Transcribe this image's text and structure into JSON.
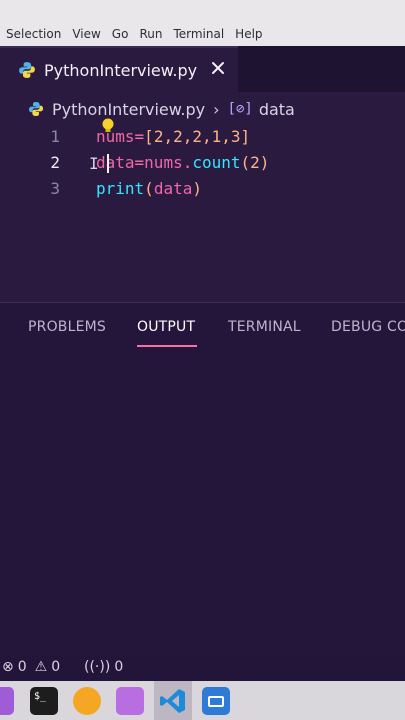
{
  "menu": [
    "Selection",
    "View",
    "Go",
    "Run",
    "Terminal",
    "Help"
  ],
  "tab": {
    "filename": "PythonInterview.py"
  },
  "breadcrumb": {
    "file": "PythonInterview.py",
    "symbol": "data"
  },
  "code": {
    "line_numbers": [
      "1",
      "2",
      "3"
    ],
    "line1": {
      "var": "nums",
      "op": "=",
      "open": "[",
      "values": "2,2,2,1,3",
      "close": "]"
    },
    "line2": {
      "var": "data",
      "op": "=",
      "obj": "nums",
      "dot": ".",
      "method": "count",
      "open": "(",
      "arg": "2",
      "close": ")"
    },
    "line3": {
      "fn": "print",
      "open": "(",
      "arg": "data",
      "close": ")"
    }
  },
  "panel_tabs": [
    "PROBLEMS",
    "OUTPUT",
    "TERMINAL",
    "DEBUG CO"
  ],
  "status": {
    "errors": "0",
    "warnings": "0",
    "ports": "0"
  },
  "colors": {
    "accent": "#ff6da9",
    "editor_bg": "#2a1a40",
    "function": "#33e6ff",
    "number": "#ffb38a"
  },
  "dock": [
    "terminal-icon",
    "firefox-icon",
    "files-icon",
    "vscode-icon",
    "screenshot-icon"
  ]
}
